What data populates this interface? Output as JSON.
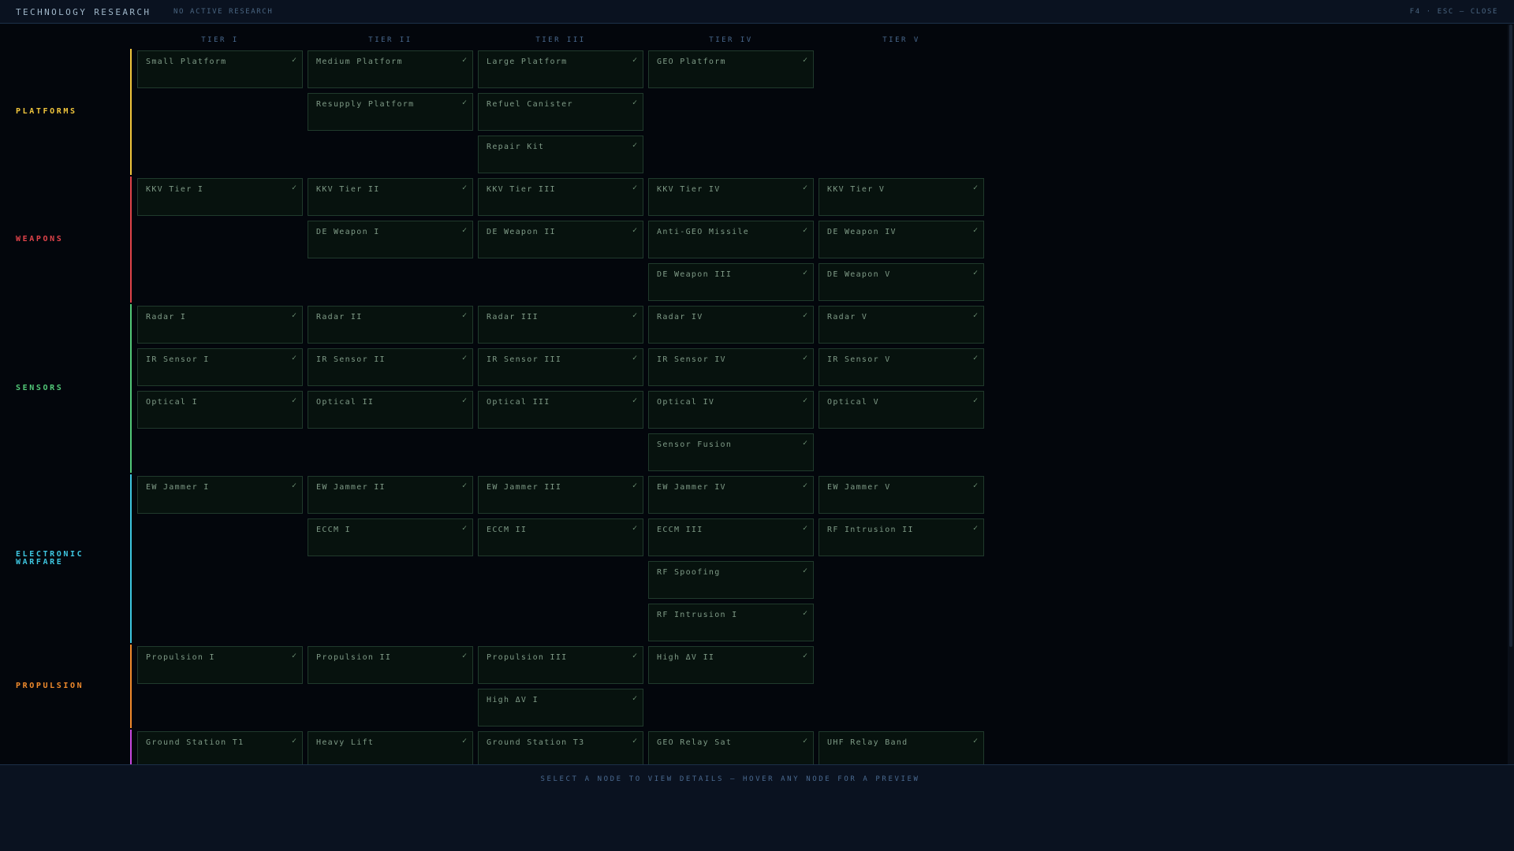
{
  "header": {
    "title": "TECHNOLOGY RESEARCH",
    "status": "NO ACTIVE RESEARCH",
    "hint": "F4 · ESC — CLOSE"
  },
  "tiers": [
    "TIER I",
    "TIER II",
    "TIER III",
    "TIER IV",
    "TIER V"
  ],
  "icons": {
    "complete": "check-icon"
  },
  "check_glyph": "✓",
  "categories": [
    {
      "id": "platforms",
      "label": "PLATFORMS",
      "color": "#f0c53c",
      "rows": [
        [
          "Small Platform",
          "Medium Platform",
          "Large Platform",
          "GEO Platform",
          null
        ],
        [
          null,
          "Resupply Platform",
          "Refuel Canister",
          null,
          null
        ],
        [
          null,
          null,
          "Repair Kit",
          null,
          null
        ]
      ]
    },
    {
      "id": "weapons",
      "label": "WEAPONS",
      "color": "#e0434a",
      "rows": [
        [
          "KKV Tier I",
          "KKV Tier II",
          "KKV Tier III",
          "KKV Tier IV",
          "KKV Tier V"
        ],
        [
          null,
          "DE Weapon I",
          "DE Weapon II",
          "Anti-GEO Missile",
          "DE Weapon IV"
        ],
        [
          null,
          null,
          null,
          "DE Weapon III",
          "DE Weapon V"
        ]
      ]
    },
    {
      "id": "sensors",
      "label": "SENSORS",
      "color": "#52c878",
      "rows": [
        [
          "Radar I",
          "Radar II",
          "Radar III",
          "Radar IV",
          "Radar V"
        ],
        [
          "IR Sensor I",
          "IR Sensor II",
          "IR Sensor III",
          "IR Sensor IV",
          "IR Sensor V"
        ],
        [
          "Optical I",
          "Optical II",
          "Optical III",
          "Optical IV",
          "Optical V"
        ],
        [
          null,
          null,
          null,
          "Sensor Fusion",
          null
        ]
      ]
    },
    {
      "id": "electronic-warfare",
      "label_lines": [
        "ELECTRONIC",
        "WARFARE"
      ],
      "color": "#3ec6e0",
      "rows": [
        [
          "EW Jammer I",
          "EW Jammer II",
          "EW Jammer III",
          "EW Jammer IV",
          "EW Jammer V"
        ],
        [
          null,
          "ECCM I",
          "ECCM II",
          "ECCM III",
          "RF Intrusion II"
        ],
        [
          null,
          null,
          null,
          "RF Spoofing",
          null
        ],
        [
          null,
          null,
          null,
          "RF Intrusion I",
          null
        ]
      ]
    },
    {
      "id": "propulsion",
      "label": "PROPULSION",
      "color": "#f08a2c",
      "rows": [
        [
          "Propulsion I",
          "Propulsion II",
          "Propulsion III",
          "High ΔV II",
          null
        ],
        [
          null,
          null,
          "High ΔV I",
          null,
          null
        ]
      ]
    },
    {
      "id": "communications",
      "label": "",
      "color": "#c848e0",
      "rows": [
        [
          "Ground Station T1",
          "Heavy Lift",
          "Ground Station T3",
          "GEO Relay Sat",
          "UHF Relay Band"
        ]
      ]
    }
  ],
  "footer": {
    "prompt": "SELECT A NODE TO VIEW DETAILS — HOVER ANY NODE FOR A PREVIEW"
  }
}
